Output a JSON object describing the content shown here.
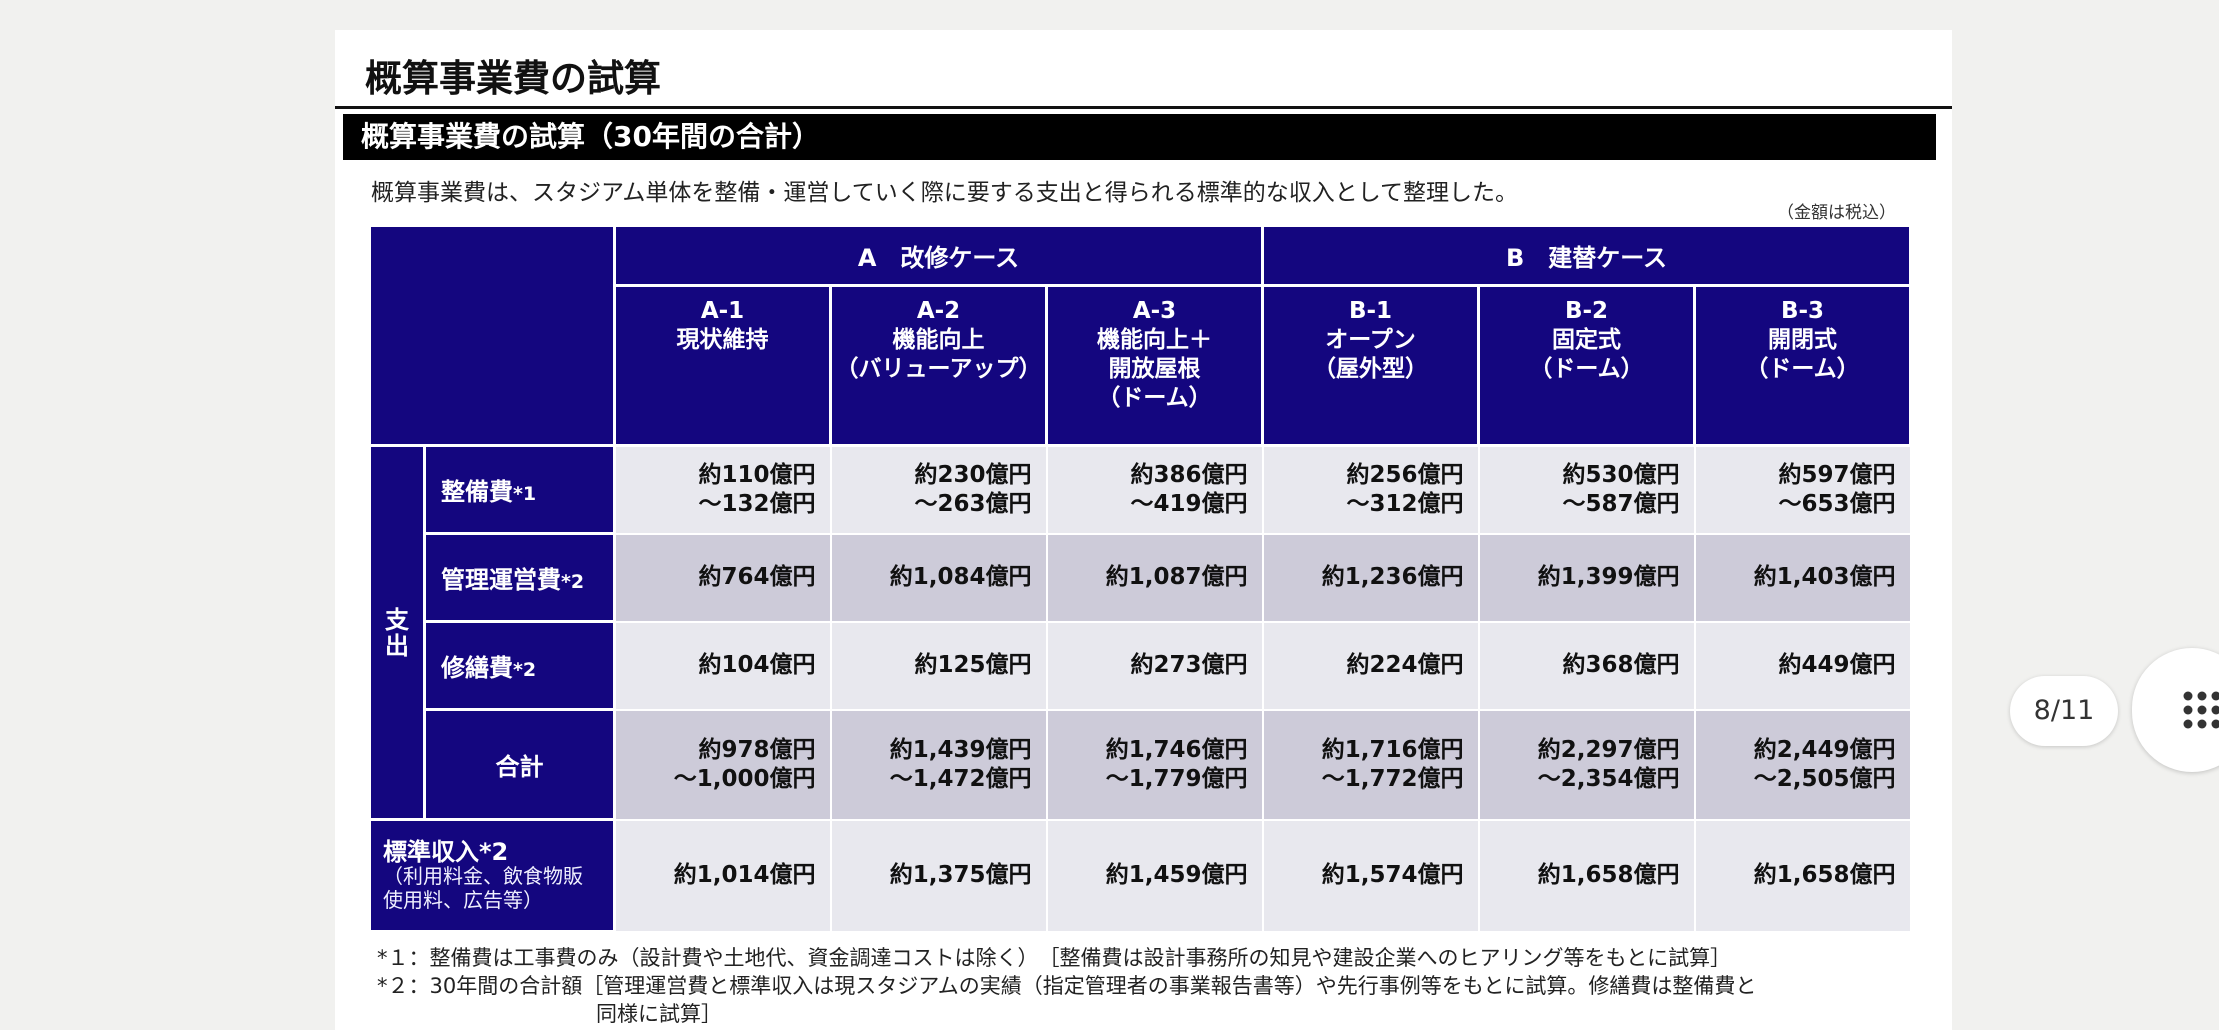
{
  "slide": {
    "title": "概算事業費の試算",
    "section": "概算事業費の試算（30年間の合計）",
    "intro": "概算事業費は、スタジアム単体を整備・運営していく際に要する支出と得られる標準的な収入として整理した。",
    "tax_note": "（金額は税込）"
  },
  "table": {
    "group_a": "A　改修ケース",
    "group_b": "B　建替ケース",
    "columns": [
      [
        "A-1",
        "現状維持"
      ],
      [
        "A-2",
        "機能向上",
        "（バリューアップ）"
      ],
      [
        "A-3",
        "機能向上＋",
        "開放屋根",
        "（ドーム）"
      ],
      [
        "B-1",
        "オープン",
        "（屋外型）"
      ],
      [
        "B-2",
        "固定式",
        "（ドーム）"
      ],
      [
        "B-3",
        "開閉式",
        "（ドーム）"
      ]
    ],
    "expense_label_top": "支",
    "expense_label_bottom": "出",
    "rows": {
      "seibi": {
        "label": "整備費",
        "mark": "*1",
        "values": [
          [
            "約110億円",
            "～132億円"
          ],
          [
            "約230億円",
            "～263億円"
          ],
          [
            "約386億円",
            "～419億円"
          ],
          [
            "約256億円",
            "～312億円"
          ],
          [
            "約530億円",
            "～587億円"
          ],
          [
            "約597億円",
            "～653億円"
          ]
        ]
      },
      "kanri": {
        "label": "管理運営費",
        "mark": "*2",
        "values": [
          "約764億円",
          "約1,084億円",
          "約1,087億円",
          "約1,236億円",
          "約1,399億円",
          "約1,403億円"
        ]
      },
      "shuzen": {
        "label": "修繕費",
        "mark": "*2",
        "values": [
          "約104億円",
          "約125億円",
          "約273億円",
          "約224億円",
          "約368億円",
          "約449億円"
        ]
      },
      "total": {
        "label": "合計",
        "values": [
          [
            "約978億円",
            "～1,000億円"
          ],
          [
            "約1,439億円",
            "～1,472億円"
          ],
          [
            "約1,746億円",
            "～1,779億円"
          ],
          [
            "約1,716億円",
            "～1,772億円"
          ],
          [
            "約2,297億円",
            "～2,354億円"
          ],
          [
            "約2,449億円",
            "～2,505億円"
          ]
        ]
      },
      "income": {
        "label": "標準収入*2",
        "note1": "（利用料金、飲食物販",
        "note2": "使用料、広告等）",
        "values": [
          "約1,014億円",
          "約1,375億円",
          "約1,459億円",
          "約1,574億円",
          "約1,658億円",
          "約1,658億円"
        ]
      }
    }
  },
  "footnotes": {
    "fn1": "*１：整備費は工事費のみ（設計費や土地代、資金調達コストは除く）　［整備費は設計事務所の知見や建設企業へのヒアリング等をもとに試算］",
    "fn2": "*２：30年間の合計額［管理運営費と標準収入は現スタジアムの実績（指定管理者の事業報告書等）や先行事例等をもとに試算。修繕費は整備費と",
    "fn2_cont": "同様に試算］"
  },
  "viewer": {
    "page_indicator": "8/11",
    "menu_icon": "grid-dots-icon"
  }
}
